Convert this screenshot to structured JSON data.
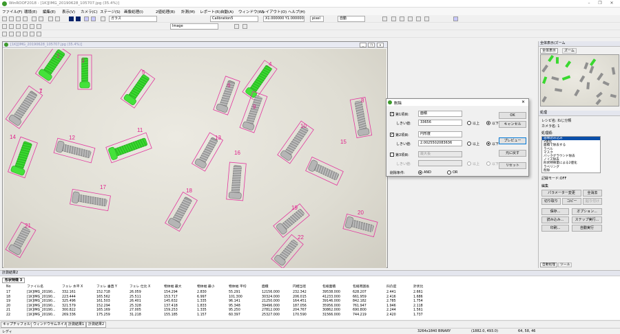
{
  "window": {
    "title": "WinROOF2018 - [1K][IMG_20190628_105707.jpg (35.4%)]"
  },
  "menu": [
    "ファイル(F)",
    "環境(E)",
    "編集(E)",
    "表示(V)",
    "カメラ(C)",
    "ステージ(S)",
    "画像処理(I)",
    "2値処理(B)",
    "計測(M)",
    "レポート(R)",
    "自動(A)",
    "ウィンドウ(W)",
    "レイアウト(O)",
    "ヘルプ(H)"
  ],
  "toolbar": {
    "glass_label": "ガラス",
    "calibration": "Calibration5",
    "image_mode": "Image",
    "zoom_scale": "X1.000000  Y1.000000",
    "unit": "pixel",
    "auto_label": "自動"
  },
  "image_window": {
    "title": "[1K][IMG_20190628_105707.jpg (35.4%)]"
  },
  "labels": [
    "1",
    "2",
    "3",
    "4",
    "5",
    "6",
    "7",
    "8",
    "9",
    "10",
    "11",
    "12",
    "13",
    "14",
    "15",
    "16",
    "17",
    "18",
    "19",
    "20",
    "21",
    "22"
  ],
  "dialog": {
    "title": "削除",
    "ok": "OK",
    "cancel": "キャンセル",
    "preview": "プレビュー",
    "restore": "元に戻す",
    "reset": "リセット",
    "item1_label": "第1項目:",
    "item1_value": "面積",
    "item2_label": "第2項目:",
    "item2_value": "円形度",
    "item3_label": "第3項目:",
    "item3_value": "最大長",
    "threshold_label": "しきい値:",
    "th1": "33656",
    "th2": "2.0025502083636",
    "th3": "",
    "above": "以上",
    "below": "以下",
    "cond_label": "削除条件:",
    "and": "AND",
    "or": "OR"
  },
  "right_panel": {
    "overview_title": "全体表示/ズーム",
    "tab_full": "全体表示",
    "tab_zoom": "ズーム",
    "proc_title": "処理",
    "recipe_label": "レシピ名: ねじ分類",
    "camera_label": "カメラ名: 1",
    "step_label": "処理順:",
    "list_items": [
      "画像読み込み",
      "2値化",
      "面積で除去する",
      "ラベル",
      "マスク",
      "バックグラウンド除去",
      "ノイズ除去",
      "形状特徴量による2値化",
      "ラベリング",
      "削除"
    ],
    "auto_mode": "記録モード:OFF",
    "edit_label": "編集",
    "param_change": "パラメーター変更",
    "delete_all": "全消去",
    "cut": "切り取り",
    "copy": "コピー",
    "paste": "貼り付け",
    "save": "保存...",
    "option": "オプション...",
    "load": "読み込み...",
    "step_exec": "ステップ実行...",
    "print": "印刷...",
    "auto_exec": "自動実行",
    "bottom_tab1": "自動処理",
    "bottom_tab2": "ツール"
  },
  "results": {
    "panel_title": "計測結果2",
    "tab": "形状特徴 3",
    "headers": [
      "No",
      "ファイル名",
      "フェレ 水平 X",
      "フェレ 垂直 Y",
      "フェレ 仕比 X",
      "物体幅 最大",
      "物体幅 最小",
      "物体幅 平均",
      "面積",
      "円相当径",
      "包絡面積",
      "包絡周囲長",
      "凹凸度",
      "針状比"
    ],
    "rows": [
      [
        "17",
        "[1K]IMG_20190...",
        "332.161",
        "152.718",
        "26.059",
        "154.294",
        "2.830",
        "55.291",
        "12156.000",
        "232.342",
        "39538.000",
        "628.207",
        "2.441",
        "2.661"
      ],
      [
        "18",
        "[1K]IMG_20190...",
        "223.444",
        "165.562",
        "25.511",
        "153.717",
        "6.997",
        "101.300",
        "30324.000",
        "206.015",
        "41233.000",
        "661.959",
        "2.416",
        "1.686"
      ],
      [
        "19",
        "[1K]IMG_20190...",
        "325.496",
        "161.503",
        "26.401",
        "145.632",
        "1.335",
        "96.141",
        "21250.000",
        "164.451",
        "39146.000",
        "842.182",
        "2.785",
        "1.754"
      ],
      [
        "20",
        "[1K]IMG_20190...",
        "321.579",
        "152.294",
        "25.328",
        "137.418",
        "1.833",
        "95.348",
        "39496.000",
        "187.056",
        "35956.000",
        "761.947",
        "1.946",
        "2.118"
      ],
      [
        "21",
        "[1K]IMG_20190...",
        "300.822",
        "165.169",
        "27.005",
        "159.253",
        "1.335",
        "95.250",
        "27812.000",
        "204.767",
        "30862.000",
        "690.800",
        "2.244",
        "1.561"
      ],
      [
        "22",
        "[1K]IMG_20190...",
        "269.336",
        "175.259",
        "31.218",
        "155.185",
        "1.157",
        "60.397",
        "25327.000",
        "170.590",
        "31566.000",
        "744.219",
        "2.420",
        "1.737"
      ]
    ]
  },
  "bottom_tabs": [
    "キャプチャフォルダー",
    "ウィンドウサムネイル",
    "計測結果1",
    "計測結果2"
  ],
  "status": {
    "left": "レディ",
    "image_info": "3264x1840 BINARY",
    "coords": "(1882.0, 493.0)",
    "rgb": "64, 58, 46"
  }
}
